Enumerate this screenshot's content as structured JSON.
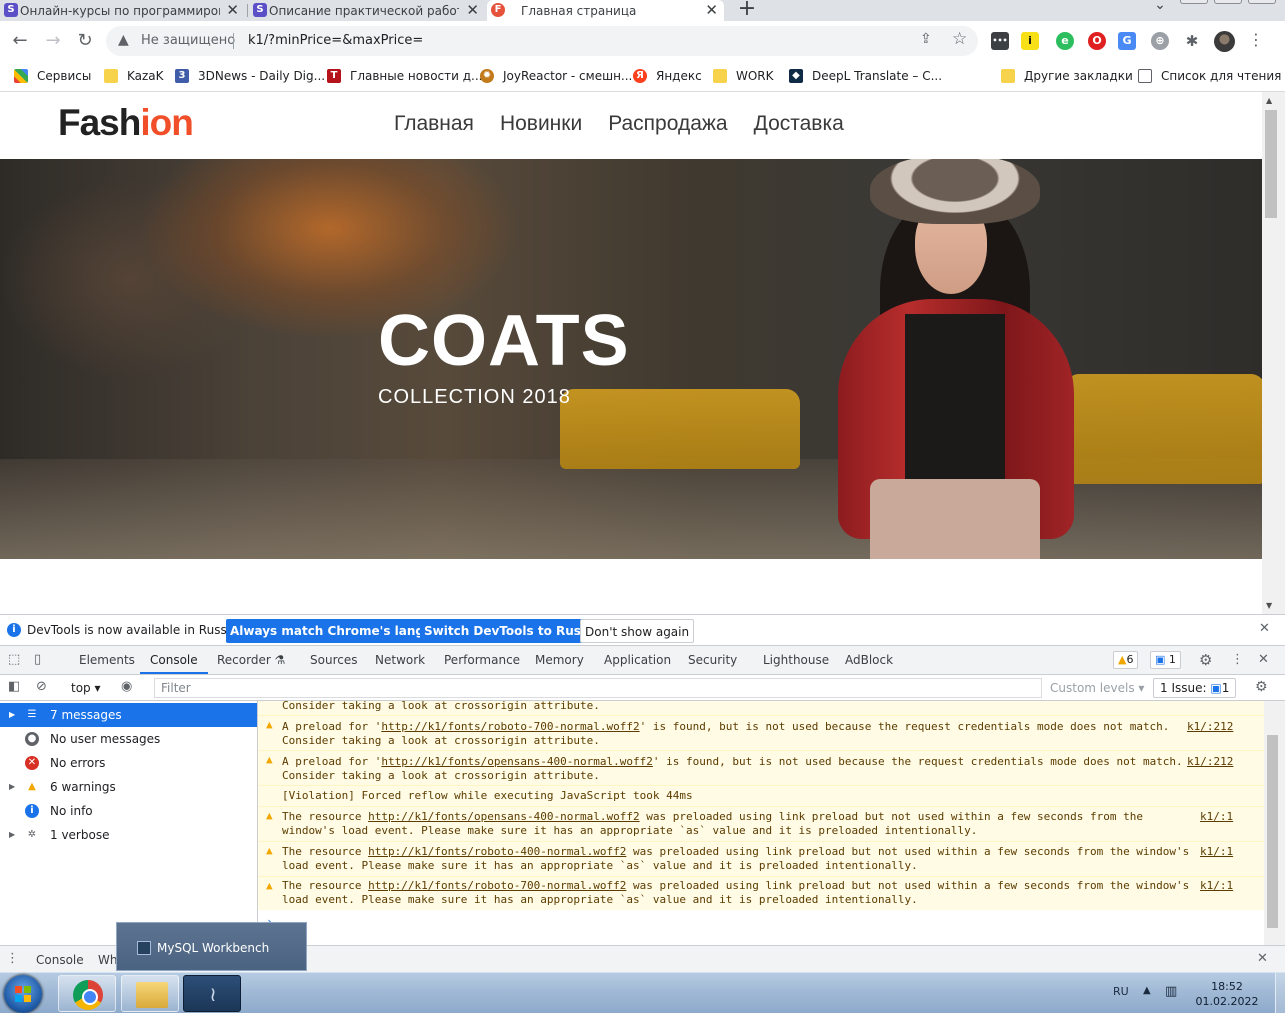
{
  "browser": {
    "tabs": [
      {
        "label": "Онлайн-курсы по программирова",
        "favicon": "S",
        "color": "#5b4fc8"
      },
      {
        "label": "Описание практической работы",
        "favicon": "S",
        "color": "#5b4fc8"
      },
      {
        "label": "Главная страница",
        "favicon": "F",
        "color": "#e5533d"
      }
    ],
    "address": {
      "security_label": "Не защищено",
      "url": "k1/?minPrice=&maxPrice="
    },
    "bookmarks": [
      {
        "label": "Сервисы",
        "icon": "apps-grid-icon"
      },
      {
        "label": "KazaK",
        "icon": "folder-icon"
      },
      {
        "label": "3DNews - Daily Dig...",
        "icon": "3dnews-icon"
      },
      {
        "label": "Главные новости д...",
        "icon": "t-news-icon"
      },
      {
        "label": "JoyReactor - смешн...",
        "icon": "joyreactor-icon"
      },
      {
        "label": "Яндекс",
        "icon": "yandex-icon"
      },
      {
        "label": "WORK",
        "icon": "folder-icon"
      },
      {
        "label": "DeepL Translate – C...",
        "icon": "deepl-icon"
      },
      {
        "label": "Другие закладки",
        "icon": "folder-icon"
      },
      {
        "label": "Список для чтения",
        "icon": "reading-list-icon"
      }
    ]
  },
  "site": {
    "logo_main": "Fash",
    "logo_accent": "ion",
    "accent_color": "#f14f2a",
    "nav": [
      "Главная",
      "Новинки",
      "Распродажа",
      "Доставка"
    ],
    "hero_title": "COATS",
    "hero_subtitle": "COLLECTION 2018"
  },
  "devtools": {
    "infobar": {
      "text": "DevTools is now available in Russian!",
      "btn_match": "Always match Chrome's language",
      "btn_switch": "Switch DevTools to Russian",
      "btn_dont": "Don't show again"
    },
    "tabs": [
      "Elements",
      "Console",
      "Recorder",
      "Sources",
      "Network",
      "Performance",
      "Memory",
      "Application",
      "Security",
      "Lighthouse",
      "AdBlock"
    ],
    "active_tab": "Console",
    "warn_count": "6",
    "msg_count": "1",
    "context": "top",
    "filter_placeholder": "Filter",
    "levels": "Custom levels",
    "issues": "1 Issue:",
    "issues_count": "1",
    "sidebar": [
      {
        "label": "7 messages",
        "icon": "list-icon"
      },
      {
        "label": "No user messages",
        "icon": "user-icon"
      },
      {
        "label": "No errors",
        "icon": "error-icon"
      },
      {
        "label": "6 warnings",
        "icon": "warning-icon"
      },
      {
        "label": "No info",
        "icon": "info-icon"
      },
      {
        "label": "1 verbose",
        "icon": "bug-icon"
      }
    ],
    "messages": [
      {
        "type": "warning",
        "line1": "Consider taking a look at crossorigin attribute.",
        "line2": "",
        "src": ""
      },
      {
        "type": "warning",
        "pre": "A preload for '",
        "link": "http://k1/fonts/roboto-700-normal.woff2",
        "post": "' is found, but is not used because the request credentials mode does not match.",
        "line2": "Consider taking a look at crossorigin attribute.",
        "src": "k1/:212"
      },
      {
        "type": "warning",
        "pre": "A preload for '",
        "link": "http://k1/fonts/opensans-400-normal.woff2",
        "post": "' is found, but is not used because the request credentials mode does not match.",
        "line2": "Consider taking a look at crossorigin attribute.",
        "src": "k1/:212"
      },
      {
        "type": "verbose",
        "line1": "[Violation] Forced reflow while executing JavaScript took 44ms",
        "line2": "",
        "src": ""
      },
      {
        "type": "warning",
        "pre": "The resource ",
        "link": "http://k1/fonts/opensans-400-normal.woff2",
        "post": " was preloaded using link preload but not used within a few seconds from the",
        "line2": "window's load event. Please make sure it has an appropriate `as` value and it is preloaded intentionally.",
        "src": "k1/:1"
      },
      {
        "type": "warning",
        "pre": "The resource ",
        "link": "http://k1/fonts/roboto-400-normal.woff2",
        "post": " was preloaded using link preload but not used within a few seconds from the window's",
        "line2": "load event. Please make sure it has an appropriate `as` value and it is preloaded intentionally.",
        "src": "k1/:1"
      },
      {
        "type": "warning",
        "pre": "The resource ",
        "link": "http://k1/fonts/roboto-700-normal.woff2",
        "post": " was preloaded using link preload but not used within a few seconds from the window's",
        "line2": "load event. Please make sure it has an appropriate `as` value and it is preloaded intentionally.",
        "src": "k1/:1"
      }
    ],
    "drawer_tabs": [
      "Console",
      "Wh"
    ]
  },
  "taskbar": {
    "tooltip": "MySQL Workbench",
    "lang": "RU",
    "time": "18:52",
    "date": "01.02.2022"
  }
}
